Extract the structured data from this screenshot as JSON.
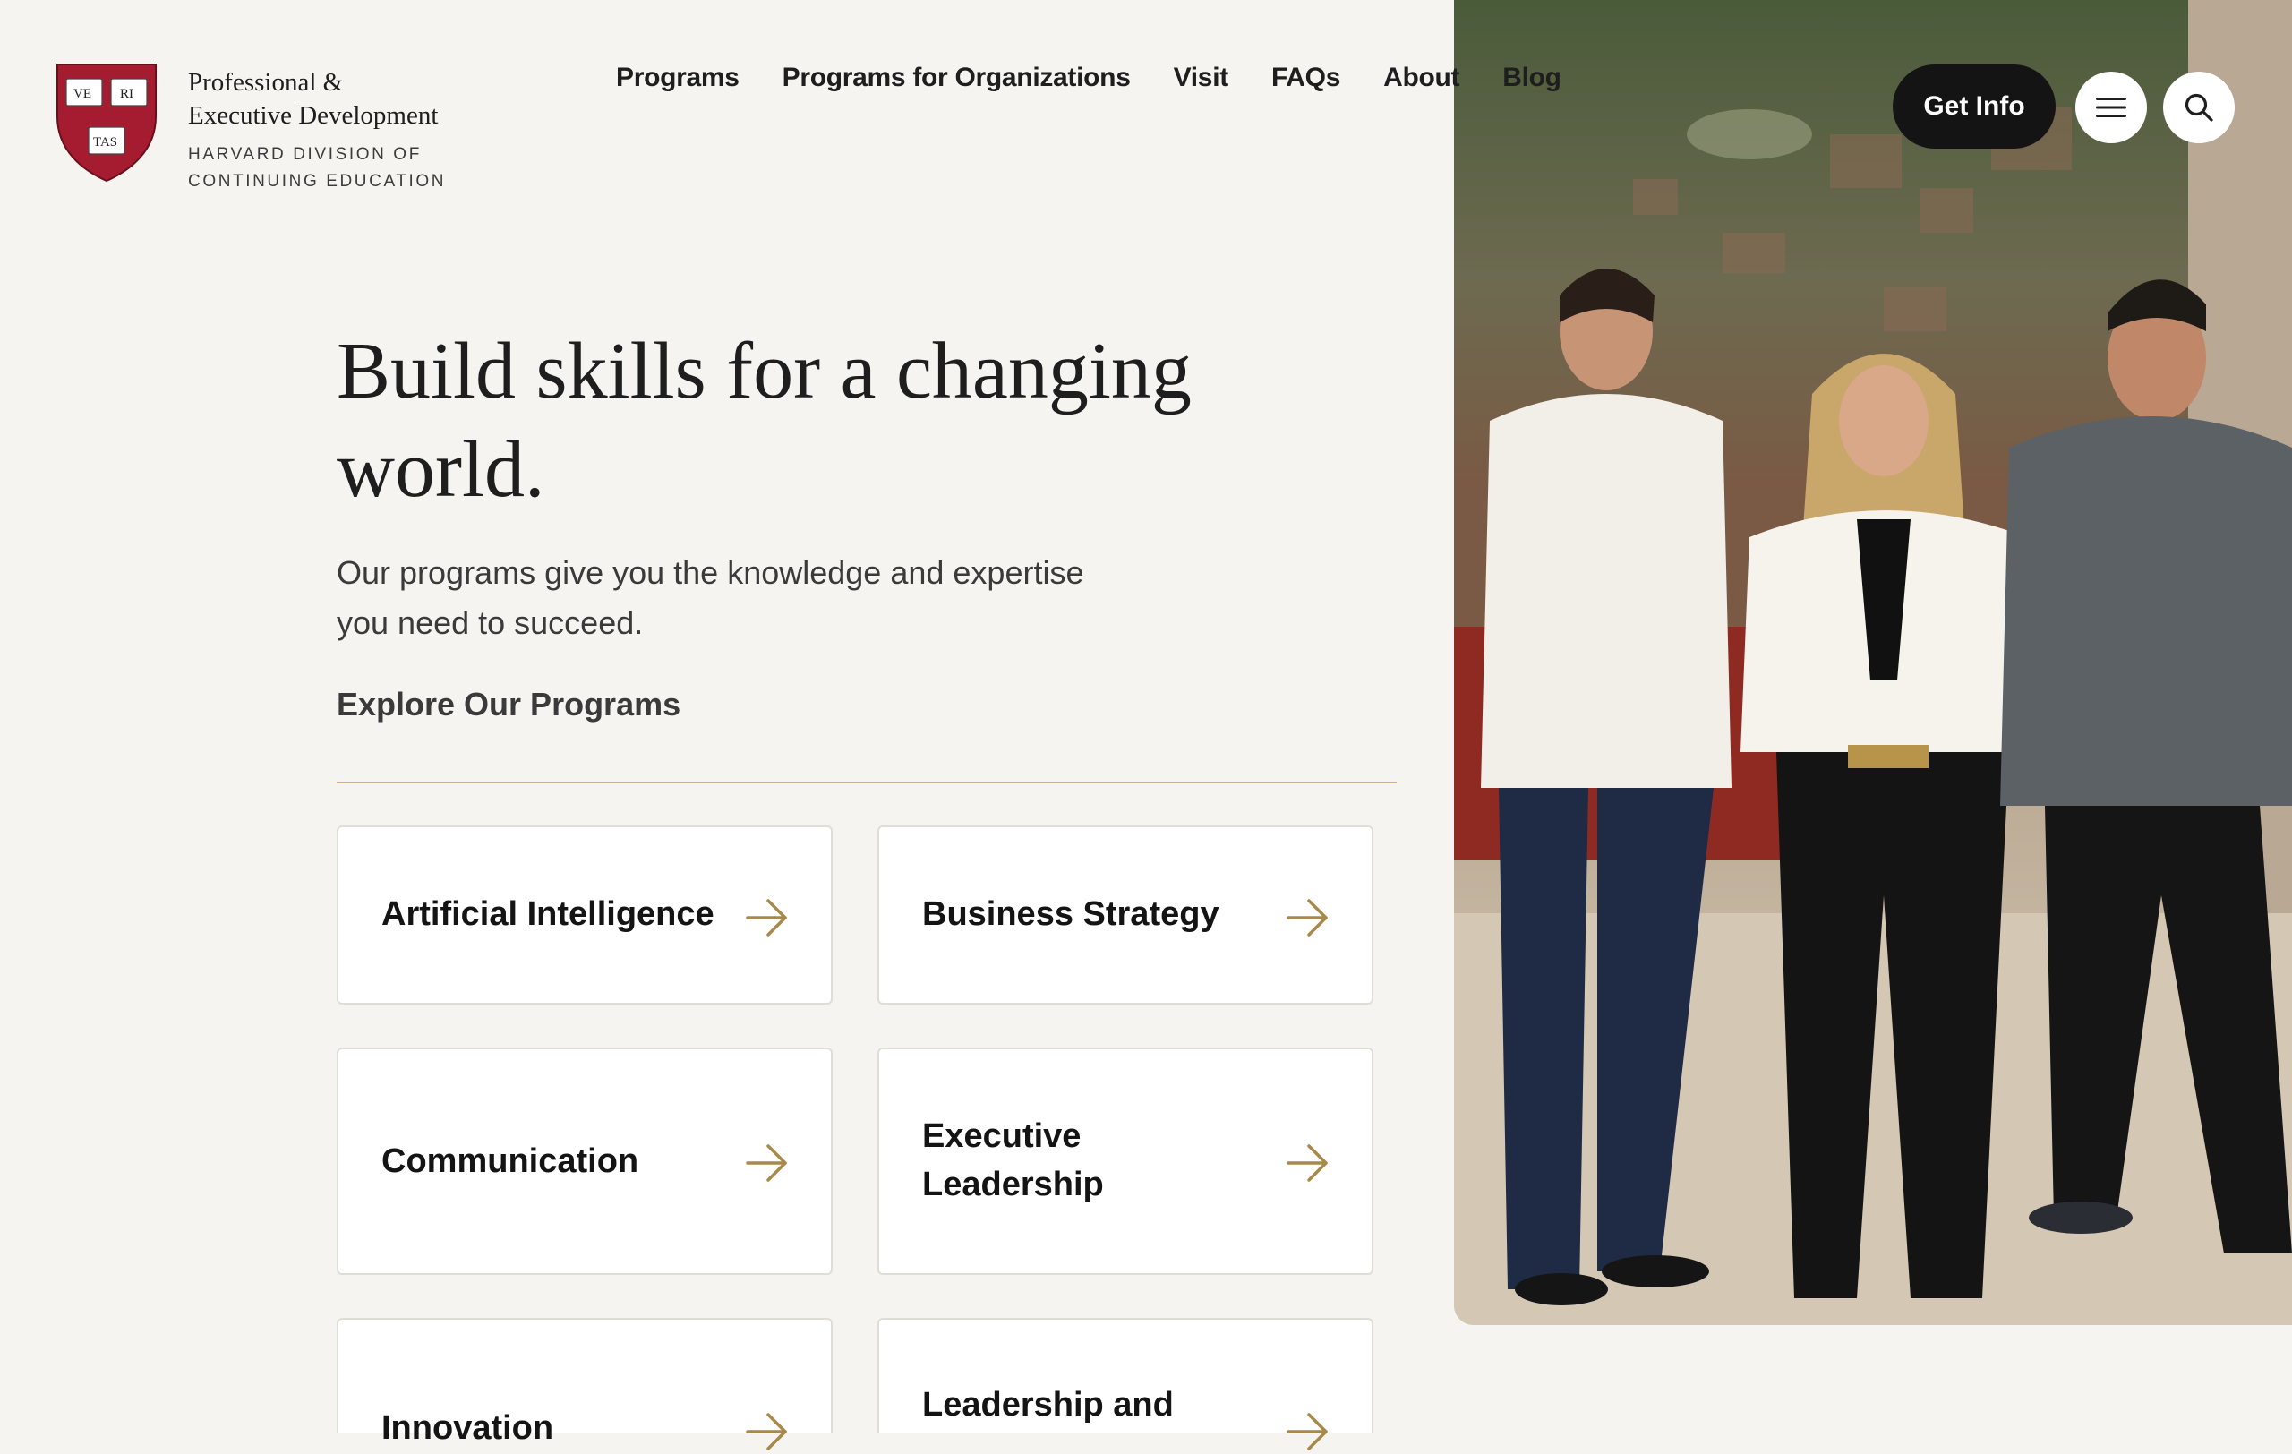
{
  "logo": {
    "title_line1": "Professional &",
    "title_line2": "Executive Development",
    "sub_line1": "HARVARD DIVISION OF",
    "sub_line2": "CONTINUING EDUCATION",
    "shield_text": [
      "VE",
      "RI",
      "TAS"
    ]
  },
  "nav": [
    "Programs",
    "Programs for Organizations",
    "Visit",
    "FAQs",
    "About",
    "Blog"
  ],
  "header_buttons": {
    "get_info": "Get Info",
    "menu_icon": "menu-icon",
    "search_icon": "search-icon"
  },
  "hero": {
    "headline": "Build skills for a changing world.",
    "subtext": "Our programs give you the knowledge and expertise you need to succeed.",
    "cta": "Explore Our Programs"
  },
  "cards": [
    "Artificial Intelligence",
    "Business Strategy",
    "Communication",
    "Executive Leadership",
    "Innovation",
    "Leadership and"
  ],
  "colors": {
    "background": "#f5f4f0",
    "accent_gold": "#a8894c",
    "crimson": "#a51c30",
    "dark": "#141414"
  }
}
